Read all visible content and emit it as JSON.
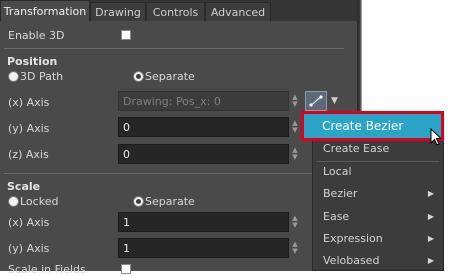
{
  "tabs": [
    "Transformation",
    "Drawing",
    "Controls",
    "Advanced"
  ],
  "enable3d": {
    "label": "Enable 3D",
    "checked": false
  },
  "position": {
    "header": "Position",
    "mode_3dpath": "3D Path",
    "mode_separate": "Separate",
    "x_label": "(x) Axis",
    "x_value": "Drawing: Pos_x: 0",
    "y_label": "(y) Axis",
    "y_value": "0",
    "z_label": "(z) Axis",
    "z_value": "0"
  },
  "scale": {
    "header": "Scale",
    "mode_locked": "Locked",
    "mode_separate": "Separate",
    "x_label": "(x) Axis",
    "x_value": "1",
    "y_label": "(y) Axis",
    "y_value": "1",
    "scale_in_fields": "Scale in Fields"
  },
  "menu": {
    "items": [
      {
        "label": "Create Bezier",
        "submenu": false
      },
      {
        "label": "Create Ease",
        "submenu": false
      },
      {
        "label": "Local",
        "submenu": false
      },
      {
        "label": "Bezier",
        "submenu": true
      },
      {
        "label": "Ease",
        "submenu": true
      },
      {
        "label": "Expression",
        "submenu": true
      },
      {
        "label": "Velobased",
        "submenu": true
      }
    ]
  },
  "colors": {
    "highlight": "#2aa4c7",
    "callout_border": "#e0001b"
  }
}
